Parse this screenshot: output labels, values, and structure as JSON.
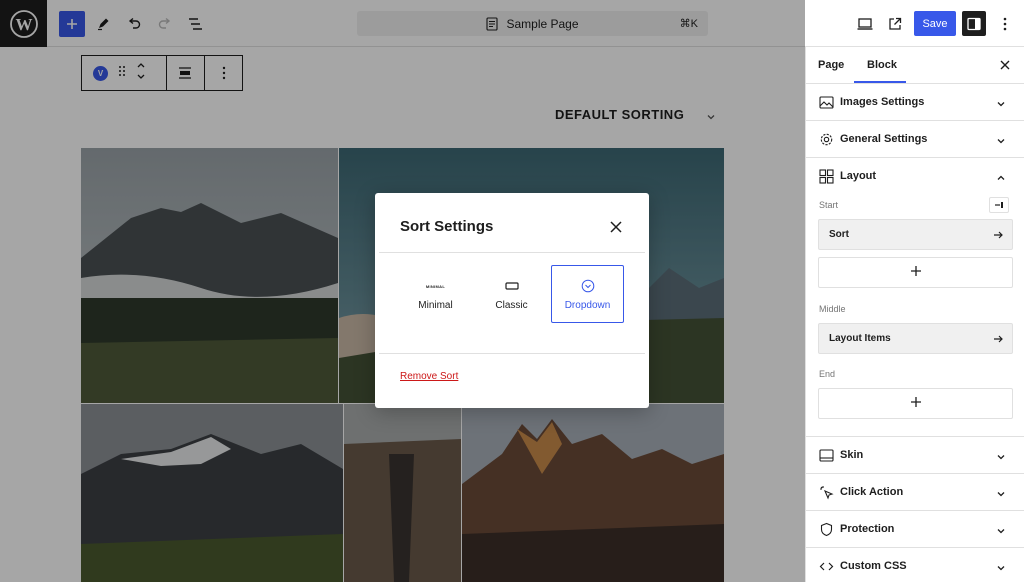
{
  "topbar": {
    "command_title": "Sample Page",
    "command_shortcut": "⌘K",
    "save_label": "Save"
  },
  "canvas": {
    "block_badge": "V",
    "sort_label": "DEFAULT SORTING"
  },
  "modal": {
    "title": "Sort Settings",
    "options": [
      {
        "label": "Minimal",
        "icon": "minimal-text-icon",
        "icon_text": "MINIMAL",
        "selected": false
      },
      {
        "label": "Classic",
        "icon": "classic-rectangle-icon",
        "selected": false
      },
      {
        "label": "Dropdown",
        "icon": "dropdown-chevron-circle-icon",
        "selected": true
      }
    ],
    "remove_label": "Remove Sort"
  },
  "sidebar": {
    "tabs": [
      "Page",
      "Block"
    ],
    "active_tab": "Block",
    "panels_top": [
      {
        "label": "Images Settings",
        "icon": "images-icon"
      },
      {
        "label": "General Settings",
        "icon": "gear-icon"
      },
      {
        "label": "Layout",
        "icon": "layout-grid-icon",
        "expanded": true
      }
    ],
    "layout": {
      "start_label": "Start",
      "start_item": "Sort",
      "middle_label": "Middle",
      "middle_item": "Layout Items",
      "end_label": "End"
    },
    "panels_bottom": [
      {
        "label": "Skin",
        "icon": "skin-icon"
      },
      {
        "label": "Click Action",
        "icon": "pointer-click-icon"
      },
      {
        "label": "Protection",
        "icon": "shield-icon"
      },
      {
        "label": "Custom CSS",
        "icon": "code-icon"
      }
    ]
  },
  "colors": {
    "accent": "#3858e9",
    "danger": "#cc1818",
    "dark": "#1e1e1e"
  }
}
